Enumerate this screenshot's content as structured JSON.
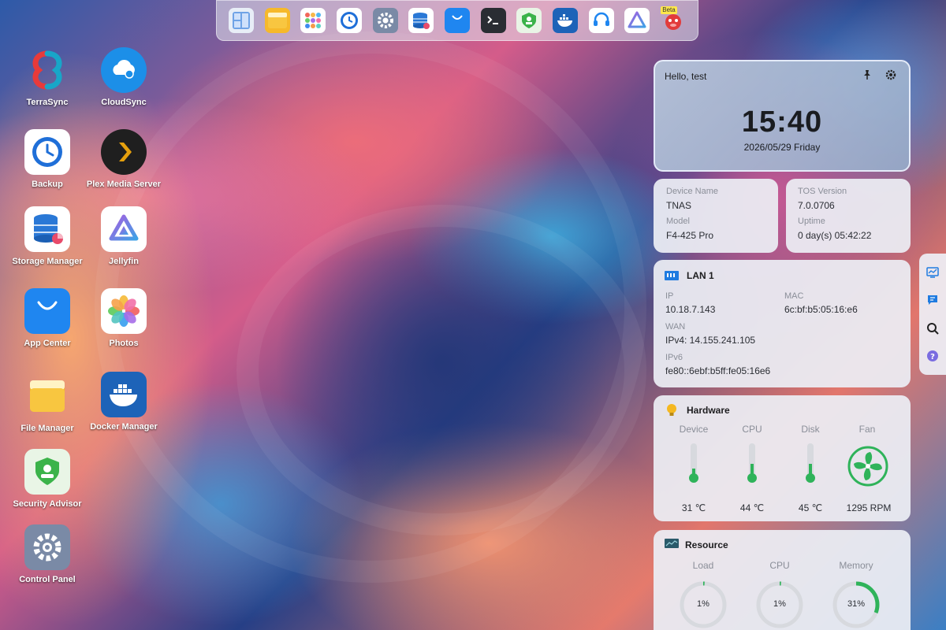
{
  "dock": [
    {
      "name": "dock-desktop-icon"
    },
    {
      "name": "dock-file-manager-icon"
    },
    {
      "name": "dock-app-launcher-icon"
    },
    {
      "name": "dock-backup-icon"
    },
    {
      "name": "dock-control-panel-icon"
    },
    {
      "name": "dock-storage-manager-icon"
    },
    {
      "name": "dock-app-center-icon"
    },
    {
      "name": "dock-terminal-icon"
    },
    {
      "name": "dock-security-advisor-icon"
    },
    {
      "name": "dock-docker-icon"
    },
    {
      "name": "dock-support-icon"
    },
    {
      "name": "dock-jellyfin-icon"
    },
    {
      "name": "dock-beta-app-icon",
      "badge": "Beta"
    }
  ],
  "desktop": {
    "apps": [
      {
        "label": "TerraSync"
      },
      {
        "label": "CloudSync"
      },
      {
        "label": "Backup"
      },
      {
        "label": "Plex Media Server"
      },
      {
        "label": "Storage Manager"
      },
      {
        "label": "Jellyfin"
      },
      {
        "label": "App Center"
      },
      {
        "label": "Photos"
      },
      {
        "label": "File Manager"
      },
      {
        "label": "Docker Manager"
      },
      {
        "label": "Security Advisor"
      },
      {
        "label": "Control Panel"
      }
    ]
  },
  "clock": {
    "greeting": "Hello, test",
    "time": "15:40",
    "date": "2026/05/29 Friday"
  },
  "device": {
    "device_name_label": "Device Name",
    "device_name": "TNAS",
    "model_label": "Model",
    "model": "F4-425 Pro"
  },
  "system": {
    "tos_label": "TOS Version",
    "tos_version": "7.0.0706",
    "uptime_label": "Uptime",
    "uptime": "0 day(s) 05:42:22"
  },
  "lan": {
    "title": "LAN 1",
    "ip_label": "IP",
    "ip": "10.18.7.143",
    "mac_label": "MAC",
    "mac": "6c:bf:b5:05:16:e6",
    "wan_label": "WAN",
    "ipv4": "IPv4: 14.155.241.105",
    "ipv6_label": "IPv6",
    "ipv6": "fe80::6ebf:b5ff:fe05:16e6"
  },
  "hardware": {
    "title": "Hardware",
    "device_label": "Device",
    "cpu_label": "CPU",
    "disk_label": "Disk",
    "fan_label": "Fan",
    "device_temp": "31 ℃",
    "cpu_temp": "44 ℃",
    "disk_temp": "45 ℃",
    "fan_speed": "1295 RPM",
    "device_level": 0.31,
    "cpu_level": 0.44,
    "disk_level": 0.45
  },
  "resource": {
    "title": "Resource",
    "load_label": "Load",
    "cpu_label": "CPU",
    "memory_label": "Memory",
    "load": "1%",
    "cpu": "1%",
    "memory": "31%",
    "load_value": 1,
    "cpu_value": 1,
    "memory_value": 31
  },
  "colors": {
    "accent_green": "#2fb35a",
    "track_gray": "#d7d9de",
    "window_blue": "#1f7be0"
  }
}
